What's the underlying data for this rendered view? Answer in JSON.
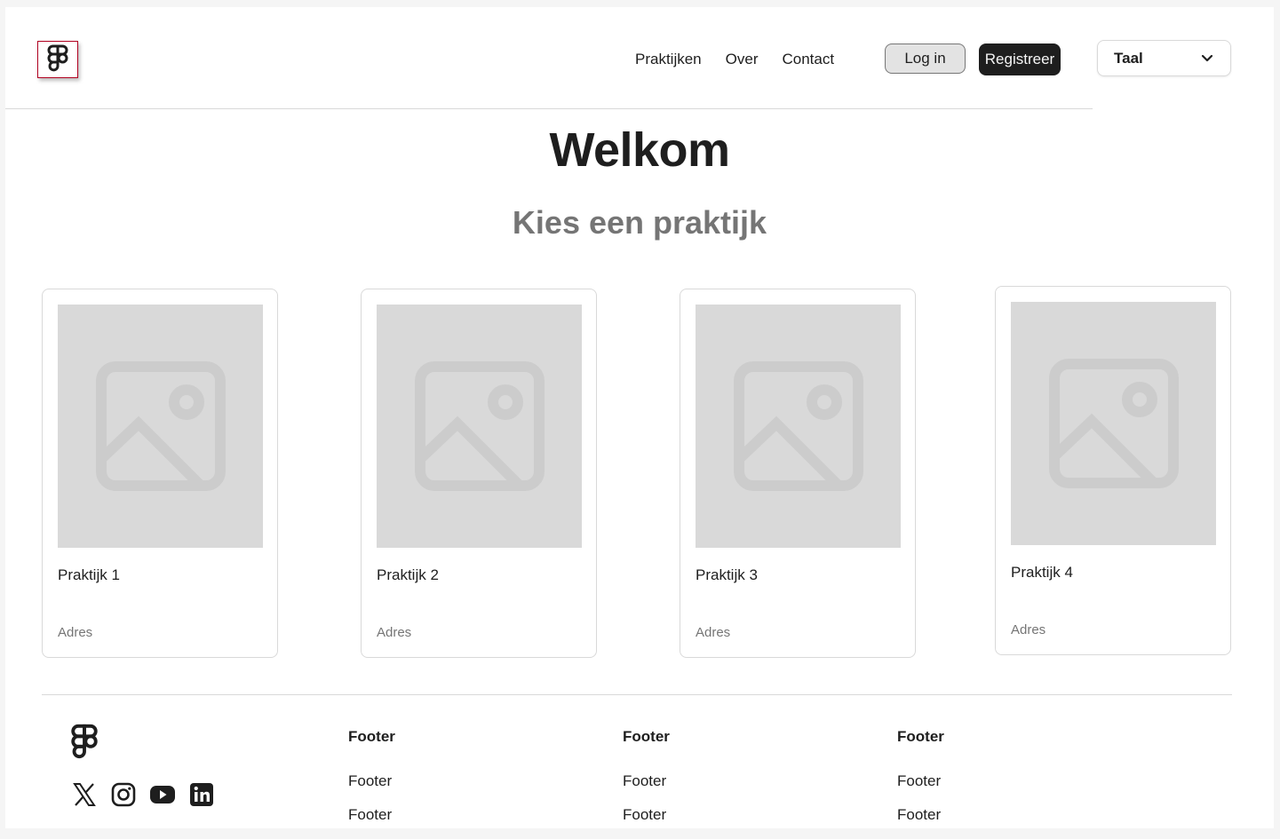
{
  "nav": {
    "links": [
      "Praktijken",
      "Over",
      "Contact"
    ],
    "login_label": "Log in",
    "register_label": "Registreer",
    "language": {
      "selected": "Taal"
    }
  },
  "hero": {
    "title": "Welkom",
    "subtitle": "Kies een praktijk"
  },
  "cards": [
    {
      "name": "Praktijk 1",
      "address": "Adres"
    },
    {
      "name": "Praktijk 2",
      "address": "Adres"
    },
    {
      "name": "Praktijk 3",
      "address": "Adres"
    },
    {
      "name": "Praktijk 4",
      "address": "Adres"
    }
  ],
  "footer": {
    "socials": [
      "x-icon",
      "instagram-icon",
      "youtube-icon",
      "linkedin-icon"
    ],
    "columns": [
      {
        "heading": "Footer",
        "links": [
          "Footer",
          "Footer"
        ]
      },
      {
        "heading": "Footer",
        "links": [
          "Footer",
          "Footer"
        ]
      },
      {
        "heading": "Footer",
        "links": [
          "Footer",
          "Footer"
        ]
      }
    ]
  },
  "colors": {
    "primary": "#1e1e1e",
    "muted": "#757575",
    "placeholder": "#d9d9d9"
  }
}
